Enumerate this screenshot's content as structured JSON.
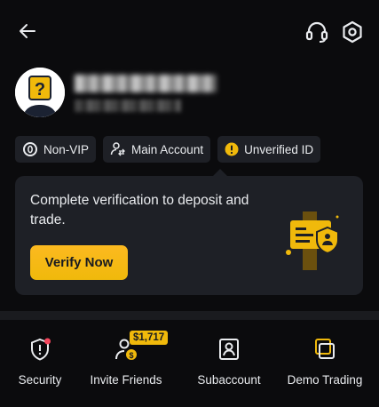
{
  "header": {
    "back_icon": "arrow-left-icon",
    "support_icon": "headset-icon",
    "settings_icon": "hexagon-gear-icon"
  },
  "profile": {
    "avatar_icon": "question-mark-avatar-icon"
  },
  "badges": [
    {
      "label": "Non-VIP",
      "icon": "vip-level-icon"
    },
    {
      "label": "Main Account",
      "icon": "user-switch-icon"
    },
    {
      "label": "Unverified ID",
      "icon": "warning-circle-icon"
    }
  ],
  "verification_card": {
    "message": "Complete verification to deposit and trade.",
    "button_label": "Verify Now",
    "illustration": "id-card-shield-icon"
  },
  "shortcuts": [
    {
      "label": "Security",
      "icon": "shield-alert-icon",
      "has_dot": true
    },
    {
      "label": "Invite Friends",
      "icon": "invite-user-icon",
      "reward": "$1,717"
    },
    {
      "label": "Subaccount",
      "icon": "subaccount-icon"
    },
    {
      "label": "Demo Trading",
      "icon": "demo-trading-icon"
    }
  ],
  "colors": {
    "background": "#0b0b0d",
    "surface": "#1e2026",
    "accent": "#f0b90b",
    "alert": "#f6465d",
    "text": "#eaecef"
  }
}
